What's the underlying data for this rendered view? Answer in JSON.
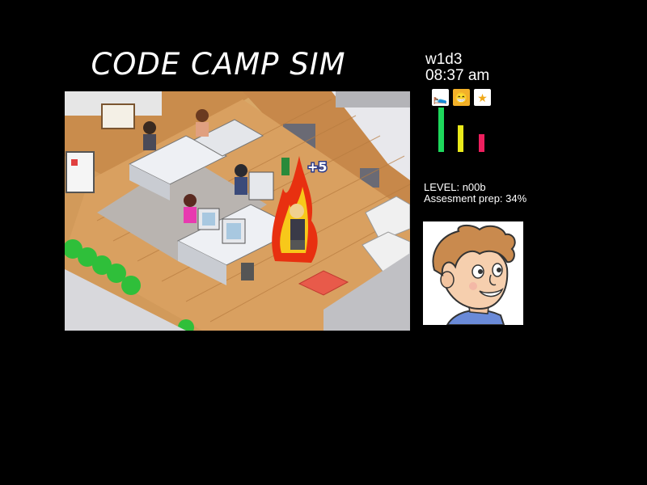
{
  "game": {
    "title": "CODE CAMP SIM",
    "week_day": "w1d3",
    "time": "08:37 am",
    "stats": [
      {
        "name": "sleep",
        "icon": "bed-icon",
        "color": "#1ed85c",
        "level": 0.92
      },
      {
        "name": "happiness",
        "icon": "smile-icon",
        "color": "#eaea1a",
        "level": 0.55
      },
      {
        "name": "reputation",
        "icon": "star-icon",
        "color": "#ee1f5e",
        "level": 0.37
      }
    ],
    "level_label": "LEVEL: n00b",
    "prep_label": "Assesment prep: 34%",
    "popup_text": "+5"
  }
}
